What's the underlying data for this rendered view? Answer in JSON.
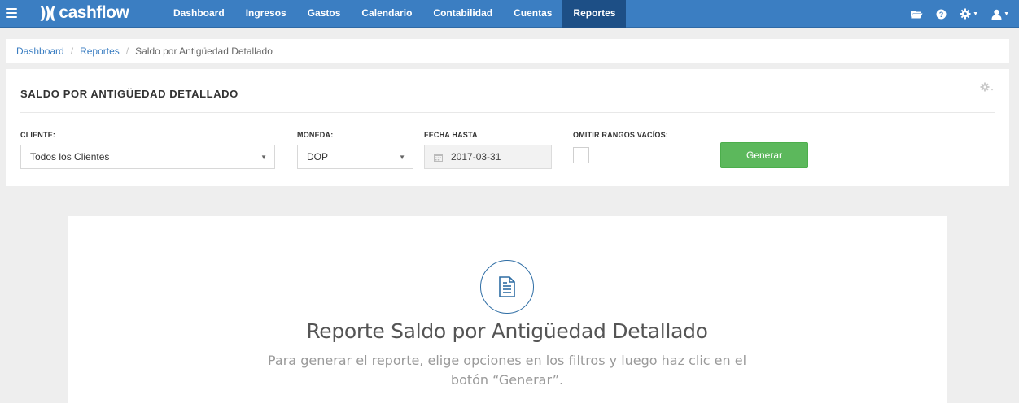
{
  "app": {
    "name": "cashflow",
    "logo_mark": "))(",
    "brand_color": "#3b7ec2",
    "active_nav_color": "#1d4f86"
  },
  "nav": {
    "items": [
      {
        "label": "Dashboard"
      },
      {
        "label": "Ingresos"
      },
      {
        "label": "Gastos"
      },
      {
        "label": "Calendario"
      },
      {
        "label": "Contabilidad"
      },
      {
        "label": "Cuentas"
      },
      {
        "label": "Reportes",
        "active": true
      }
    ],
    "right_icons": [
      "folder-open-icon",
      "help-circle-icon",
      "gear-icon",
      "user-icon"
    ]
  },
  "breadcrumb": {
    "items": [
      "Dashboard",
      "Reportes"
    ],
    "separator": "/",
    "current": "Saldo por Antigüedad Detallado"
  },
  "filters": {
    "title": "SALDO POR ANTIGÜEDAD DETALLADO",
    "cliente": {
      "label": "CLIENTE:",
      "value": "Todos los Clientes"
    },
    "moneda": {
      "label": "MONEDA:",
      "value": "DOP"
    },
    "fecha_hasta": {
      "label": "FECHA HASTA",
      "value": "2017-03-31"
    },
    "omitir": {
      "label": "OMITIR RANGOS VACÍOS:",
      "checked": false
    },
    "generate_label": "Generar",
    "generate_color": "#5cb85c"
  },
  "empty_state": {
    "icon": "document-icon",
    "title": "Reporte Saldo por Antigüedad Detallado",
    "subtitle": "Para generar el reporte, elige opciones en los filtros y luego haz clic en el botón “Generar”."
  }
}
